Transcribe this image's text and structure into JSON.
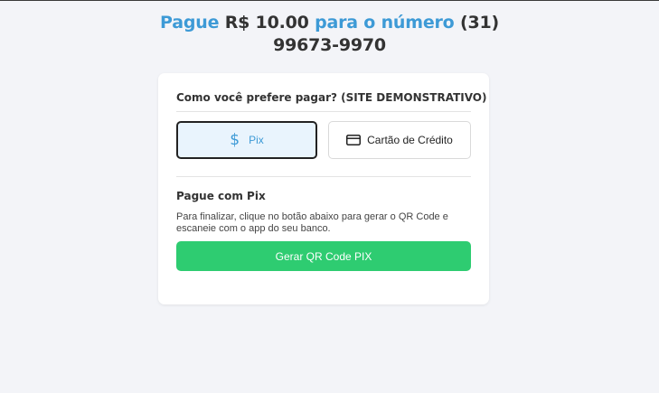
{
  "header": {
    "pay_word": "Pague",
    "amount": "R$ 10.00",
    "to_number_text": "para o número",
    "phone_area": "(31)",
    "phone_number": "99673-9970"
  },
  "payment": {
    "question": "Como você prefere pagar? (SITE DEMONSTRATIVO)",
    "options": [
      {
        "label": "Pix",
        "icon": "dollar-icon",
        "selected": true
      },
      {
        "label": "Cartão de Crédito",
        "icon": "credit-card-icon",
        "selected": false
      }
    ],
    "pix_section": {
      "title": "Pague com Pix",
      "description": "Para finalizar, clique no botão abaixo para gerar o QR Code e escaneie com o app do seu banco.",
      "button_label": "Gerar QR Code PIX"
    }
  },
  "colors": {
    "accent_blue": "#3d9ad6",
    "button_green": "#2ecc71",
    "selected_bg": "#e9f4fd",
    "page_bg": "#f3f4f8"
  }
}
